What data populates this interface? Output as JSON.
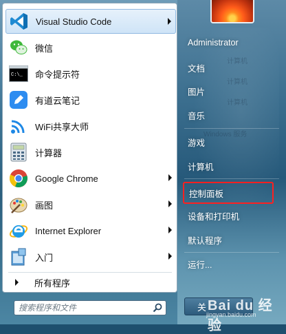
{
  "start_menu": {
    "programs": [
      {
        "label": "Visual Studio Code",
        "icon": "vscode-icon",
        "has_submenu": true
      },
      {
        "label": "微信",
        "icon": "wechat-icon",
        "has_submenu": false
      },
      {
        "label": "命令提示符",
        "icon": "command-prompt-icon",
        "has_submenu": false
      },
      {
        "label": "有道云笔记",
        "icon": "youdao-note-icon",
        "has_submenu": false
      },
      {
        "label": "WiFi共享大师",
        "icon": "wifi-share-icon",
        "has_submenu": false
      },
      {
        "label": "计算器",
        "icon": "calculator-icon",
        "has_submenu": false
      },
      {
        "label": "Google Chrome",
        "icon": "chrome-icon",
        "has_submenu": true
      },
      {
        "label": "画图",
        "icon": "paint-icon",
        "has_submenu": true
      },
      {
        "label": "Internet Explorer",
        "icon": "internet-explorer-icon",
        "has_submenu": true
      },
      {
        "label": "入门",
        "icon": "getting-started-icon",
        "has_submenu": true
      }
    ],
    "cmd_icon_text": "C:\\_",
    "all_programs": "所有程序",
    "search": {
      "placeholder": "搜索程序和文件"
    },
    "right_items": [
      {
        "label": "Administrator"
      },
      {
        "label": "文档"
      },
      {
        "label": "图片"
      },
      {
        "label": "音乐"
      },
      {
        "label": "游戏"
      },
      {
        "label": "计算机"
      },
      {
        "label": "控制面板",
        "highlighted": true
      },
      {
        "label": "设备和打印机"
      },
      {
        "label": "默认程序"
      },
      {
        "label": "运行..."
      }
    ],
    "ghost_texts": [
      "计算机",
      "计算机",
      "计算机",
      "Windows 服务"
    ],
    "shutdown_label": "关",
    "watermark": {
      "big": "Bai du 经验",
      "small": "jingyan.baidu.com"
    },
    "colors": {
      "highlight_border": "#ff2020",
      "hover_bg": "#cfe4f7"
    }
  }
}
